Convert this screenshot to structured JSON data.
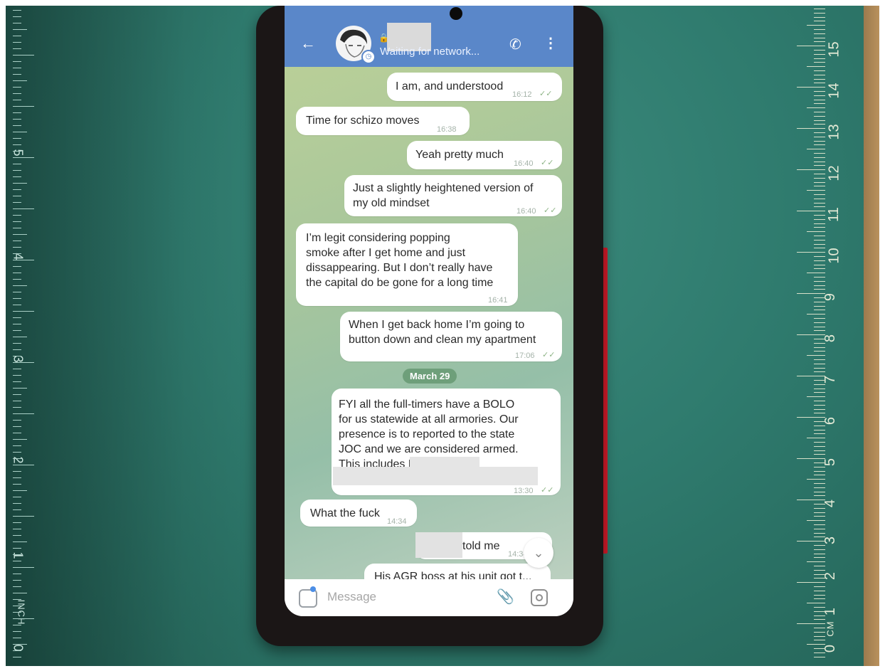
{
  "header": {
    "back_icon": "arrow-left-icon",
    "status": "Waiting for network...",
    "phone_icon": "phone-icon",
    "menu_icon": "more-vertical-icon"
  },
  "messages": [
    {
      "dir": "out",
      "text": "I am, and understood",
      "time": "16:12",
      "ticks": "✓✓"
    },
    {
      "dir": "in",
      "text": "Time for schizo moves",
      "time": "16:38"
    },
    {
      "dir": "out",
      "text": "Yeah pretty much",
      "time": "16:40",
      "ticks": "✓✓"
    },
    {
      "dir": "out",
      "text": "Just a slightly heightened version of\nmy old mindset",
      "time": "16:40",
      "ticks": "✓✓"
    },
    {
      "dir": "in",
      "text": "I’m legit considering popping\nsmoke after I get home and just\ndissappearing. But I don’t really have\nthe capital do be gone for a long time",
      "time": "16:41"
    },
    {
      "dir": "out",
      "text": "When I get back home I’m going to\nbutton down and clean my apartment",
      "time": "17:06",
      "ticks": "✓✓"
    },
    {
      "dir": "out",
      "text": "FYI all the full-timers have a BOLO\nfor us statewide at all armories. Our\npresence is to reported to the state\nJOC and we are considered armed.\nThis includes                      Myself, you,",
      "time": "13:30",
      "ticks": "✓✓"
    },
    {
      "dir": "in",
      "text": "What the fuck",
      "time": "14:34"
    },
    {
      "dir": "out",
      "text": "told me",
      "time": "14:34"
    },
    {
      "dir": "out",
      "text": "His AGR boss at his unit got t..."
    }
  ],
  "date_separator": "March 29",
  "composer": {
    "placeholder": "Message",
    "attach_icon": "paperclip-icon",
    "camera_icon": "camera-icon",
    "emoji_icon": "sticker-icon"
  },
  "rulers": {
    "left_numbers": [
      "5",
      "4",
      "3",
      "2",
      "1",
      "0"
    ],
    "left_unit": "INCH",
    "right_numbers": [
      "15",
      "14",
      "13",
      "12",
      "11",
      "10",
      "9",
      "8",
      "7",
      "6",
      "5",
      "4",
      "3",
      "2",
      "1",
      "0"
    ],
    "right_unit": "CM"
  },
  "colors": {
    "header": "#5a87c9",
    "mat": "#2f7b6e",
    "date_pill": "#6e9f7a"
  }
}
